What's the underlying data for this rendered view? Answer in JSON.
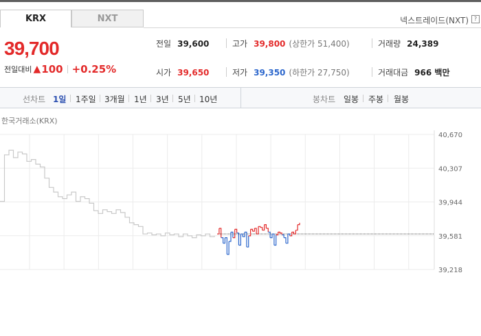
{
  "tabs": {
    "krx": "KRX",
    "nxt": "NXT"
  },
  "nxt_link": "넥스트레이드(NXT)",
  "help_icon": "?",
  "price": "39,700",
  "change": {
    "label": "전일대비",
    "direction_icon": "triangle-up-icon",
    "amount": "100",
    "percent": "+0.25%"
  },
  "stats": {
    "prev_close": {
      "label": "전일",
      "value": "39,600"
    },
    "open": {
      "label": "시가",
      "value": "39,650"
    },
    "high": {
      "label": "고가",
      "value": "39,800",
      "limit": "(상한가 51,400)"
    },
    "low": {
      "label": "저가",
      "value": "39,350",
      "limit": "(하한가 27,750)"
    },
    "volume": {
      "label": "거래량",
      "value": "24,389"
    },
    "trade_value": {
      "label": "거래대금",
      "value": "966 백만"
    }
  },
  "controls": {
    "line_label": "선차트",
    "ranges": [
      "1일",
      "1주일",
      "3개월",
      "1년",
      "3년",
      "5년",
      "10년"
    ],
    "active_range": "1일",
    "candle_label": "봉차트",
    "candles": [
      "일봉",
      "주봉",
      "월봉"
    ]
  },
  "chart_data": {
    "type": "line",
    "source": "한국거래소(KRX)",
    "yticks": [
      "40,670",
      "40,307",
      "39,944",
      "39,581",
      "39,218"
    ],
    "ylim": [
      39218,
      40670
    ],
    "reference": 39600,
    "colors": {
      "prior": "#c8c8c8",
      "up": "#e32a2a",
      "down": "#2b66cc",
      "ref": "#444444"
    },
    "prior_series": [
      39950,
      40450,
      40500,
      40420,
      40480,
      40460,
      40380,
      40400,
      40350,
      40320,
      40200,
      40100,
      40050,
      40000,
      39980,
      40020,
      40050,
      39950,
      40000,
      39980,
      39930,
      39850,
      39820,
      39860,
      39840,
      39820,
      39860,
      39830,
      39780,
      39720,
      39700,
      39680,
      39600,
      39610,
      39590,
      39600,
      39580,
      39610,
      39590,
      39600,
      39570,
      39600,
      39580,
      39560,
      39590,
      39580,
      39600,
      39570,
      39580
    ],
    "today_series": [
      39600,
      39660,
      39560,
      39500,
      39560,
      39380,
      39520,
      39620,
      39560,
      39650,
      39610,
      39480,
      39600,
      39570,
      39620,
      39460,
      39580,
      39650,
      39630,
      39660,
      39600,
      39680,
      39670,
      39640,
      39700,
      39660,
      39620,
      39560,
      39600,
      39480,
      39590,
      39620,
      39610,
      39590,
      39560,
      39500,
      39600,
      39580,
      39620,
      39600,
      39640,
      39700,
      39720
    ]
  }
}
